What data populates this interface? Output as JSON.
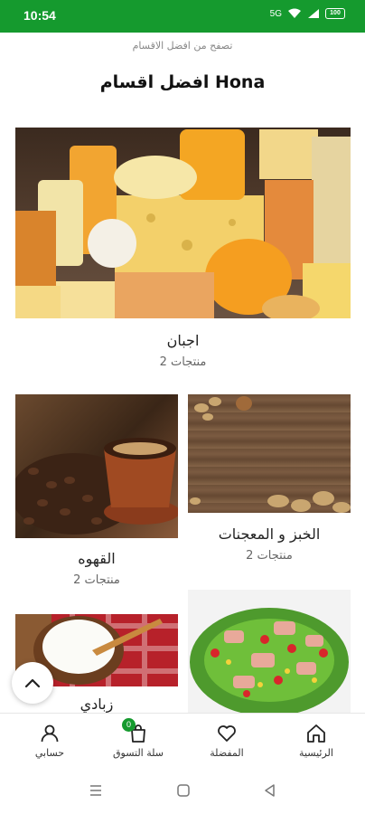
{
  "status_bar": {
    "time": "10:54",
    "network": "5G",
    "battery": "100"
  },
  "header": {
    "subtitle": "تصفح من افضل الاقسام",
    "title": "افضل اقسام Hona"
  },
  "categories": [
    {
      "name": "اجبان",
      "count": "2 منتجات"
    },
    {
      "name": "الخبز و المعجنات",
      "count": "2 منتجات"
    },
    {
      "name": "القهوه",
      "count": "2 منتجات"
    },
    {
      "name": "",
      "count": ""
    },
    {
      "name": "زبادي",
      "count": ""
    }
  ],
  "nav": {
    "home": "الرئيسية",
    "favorites": "المفضلة",
    "cart": "سلة التسوق",
    "cart_count": "0",
    "account": "حسابي"
  },
  "colors": {
    "brand_green": "#159a2e"
  },
  "icons": [
    "home-icon",
    "heart-icon",
    "cart-icon",
    "user-icon",
    "chevron-up-icon"
  ]
}
